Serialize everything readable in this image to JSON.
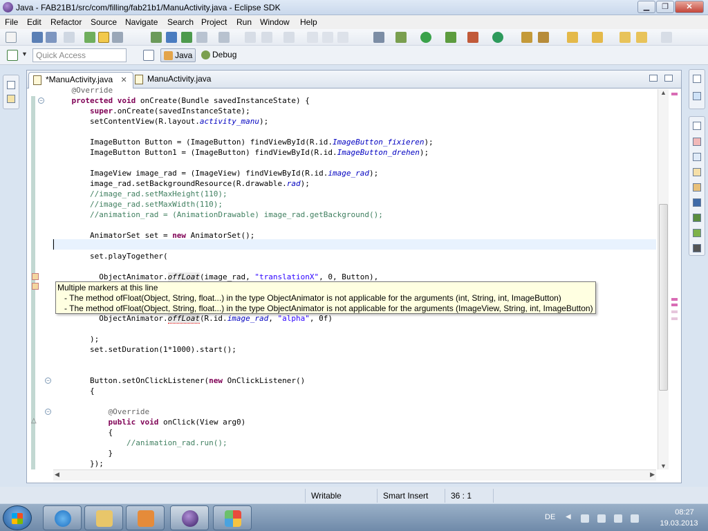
{
  "window": {
    "title": "Java - FAB21B1/src/com/filling/fab21b1/ManuActivity.java - Eclipse SDK"
  },
  "menu": [
    "File",
    "Edit",
    "Refactor",
    "Source",
    "Navigate",
    "Search",
    "Project",
    "Run",
    "Window",
    "Help"
  ],
  "quick_access": {
    "placeholder": "Quick Access"
  },
  "perspectives": [
    "Java",
    "Debug"
  ],
  "tabs": [
    {
      "label": "*ManuActivity.java",
      "close": "✕"
    },
    {
      "label": "ManuActivity.java"
    }
  ],
  "code_lines": [
    "    @Override",
    "    protected void onCreate(Bundle savedInstanceState) {",
    "        super.onCreate(savedInstanceState);",
    "        setContentView(R.layout.activity_manu);",
    "",
    "        ImageButton Button = (ImageButton) findViewById(R.id.ImageButton_fixieren);",
    "        ImageButton Button1 = (ImageButton) findViewById(R.id.ImageButton_drehen);",
    "",
    "        ImageView image_rad = (ImageView) findViewById(R.id.image_rad);",
    "        image_rad.setBackgroundResource(R.drawable.rad);",
    "        //image_rad.setMaxHeight(110);",
    "        //image_rad.setMaxWidth(110);",
    "        //animation_rad = (AnimationDrawable) image_rad.getBackground();",
    "",
    "        AnimatorSet set = new AnimatorSet();",
    "",
    "        set.playTogether(",
    "",
    "          ObjectAnimator.offLoat(image_rad, \"translationX\", 0, Button),",
    "",
    "",
    "          ObjectAnimator.offLoat(R.id.image_rad, \"alpha\", 0f)",
    "",
    "        );",
    "        set.setDuration(1*1000).start();",
    "",
    "",
    "        Button.setOnClickListener(new OnClickListener()",
    "        {",
    "",
    "            @Override",
    "            public void onClick(View arg0)",
    "            {",
    "                //animation_rad.run();",
    "            }",
    "        });"
  ],
  "hover": {
    "title": "Multiple markers at this line",
    "items": [
      "- The method ofFloat(Object, String, float...) in the type ObjectAnimator is not applicable for the arguments (int, String, int, ImageButton)",
      "- The method ofFloat(Object, String, float...) in the type ObjectAnimator is not applicable for the arguments (ImageView, String, int, ImageButton)"
    ]
  },
  "status": {
    "writable": "Writable",
    "insert_mode": "Smart Insert",
    "position": "36 : 1"
  },
  "taskbar": {
    "lang": "DE",
    "time": "08:27",
    "date": "19.03.2013"
  },
  "colors": {
    "keyword": "#7f0055",
    "comment": "#3f7f5f",
    "string": "#2a00ff",
    "field": "#0000c0",
    "current_line": "#e8f2fe"
  }
}
